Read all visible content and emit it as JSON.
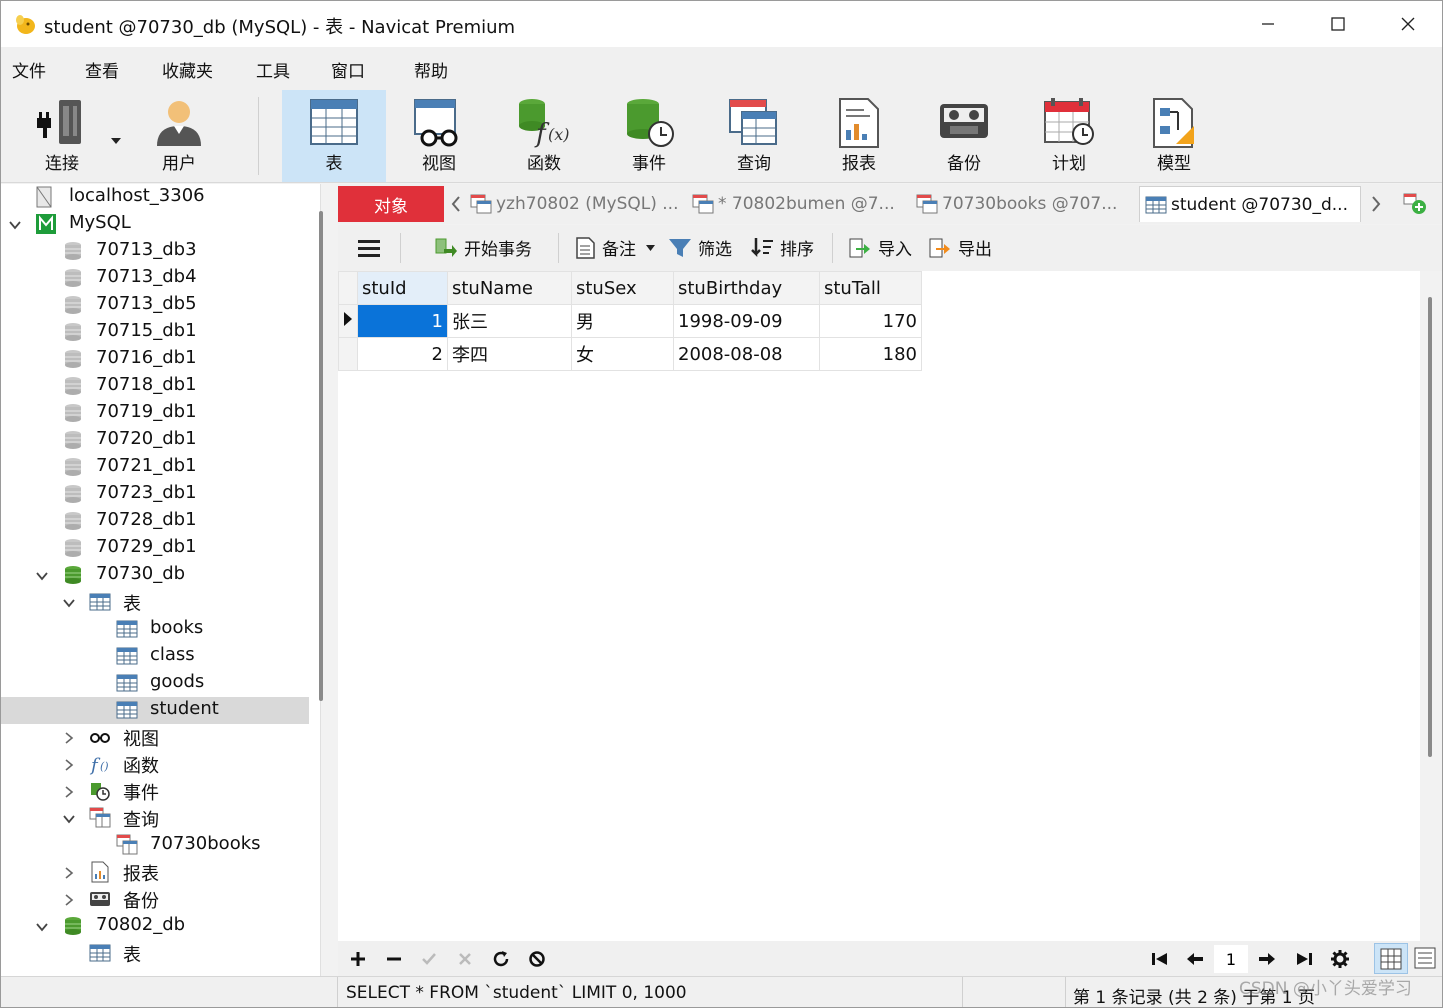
{
  "window": {
    "title": "student @70730_db (MySQL) - 表 - Navicat Premium"
  },
  "menu": [
    "文件",
    "查看",
    "收藏夹",
    "工具",
    "窗口",
    "帮助"
  ],
  "toolbar": {
    "connect": "连接",
    "user": "用户",
    "table": "表",
    "view": "视图",
    "function": "函数",
    "event": "事件",
    "query": "查询",
    "report": "报表",
    "backup": "备份",
    "schedule": "计划",
    "model": "模型"
  },
  "sidebar": {
    "items": [
      {
        "label": "localhost_3306"
      },
      {
        "label": "MySQL"
      },
      {
        "label": "70713_db3"
      },
      {
        "label": "70713_db4"
      },
      {
        "label": "70713_db5"
      },
      {
        "label": "70715_db1"
      },
      {
        "label": "70716_db1"
      },
      {
        "label": "70718_db1"
      },
      {
        "label": "70719_db1"
      },
      {
        "label": "70720_db1"
      },
      {
        "label": "70721_db1"
      },
      {
        "label": "70723_db1"
      },
      {
        "label": "70728_db1"
      },
      {
        "label": "70729_db1"
      },
      {
        "label": "70730_db"
      },
      {
        "label": "表"
      },
      {
        "label": "books"
      },
      {
        "label": "class"
      },
      {
        "label": "goods"
      },
      {
        "label": "student"
      },
      {
        "label": "视图"
      },
      {
        "label": "函数"
      },
      {
        "label": "事件"
      },
      {
        "label": "查询"
      },
      {
        "label": "70730books"
      },
      {
        "label": "报表"
      },
      {
        "label": "备份"
      },
      {
        "label": "70802_db"
      },
      {
        "label": "表"
      }
    ]
  },
  "tabs": {
    "objects": "对象",
    "items": [
      {
        "label": "yzh70802 (MySQL) ..."
      },
      {
        "label": "* 70802bumen @7..."
      },
      {
        "label": "70730books @707..."
      },
      {
        "label": "student @70730_d..."
      }
    ]
  },
  "datatoolbar": {
    "begin_transaction": "开始事务",
    "memo": "备注",
    "filter": "筛选",
    "sort": "排序",
    "import": "导入",
    "export": "导出"
  },
  "grid": {
    "columns": [
      "stuId",
      "stuName",
      "stuSex",
      "stuBirthday",
      "stuTall"
    ],
    "rows": [
      [
        "1",
        "张三",
        "男",
        "1998-09-09",
        "170"
      ],
      [
        "2",
        "李四",
        "女",
        "2008-08-08",
        "180"
      ]
    ]
  },
  "pager": {
    "page": "1"
  },
  "status": {
    "sql": "SELECT * FROM `student` LIMIT 0, 1000",
    "count": "第 1 条记录 (共 2 条) 于第 1 页",
    "watermark": "CSDN @小丫头爱学习"
  },
  "colors": {
    "accent_red": "#e0303a",
    "selection_blue": "#0a73d9",
    "toolbar_active": "#cce4f7"
  }
}
